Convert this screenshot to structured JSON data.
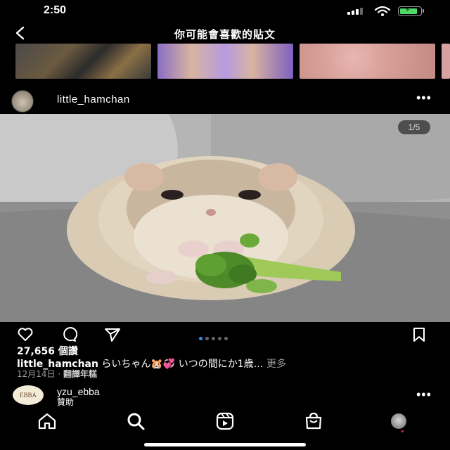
{
  "status_bar": {
    "time": "2:50"
  },
  "header": {
    "title": "你可能會喜歡的貼文"
  },
  "post": {
    "username": "little_hamchan",
    "image_counter": "1/5",
    "carousel": {
      "total": 5,
      "active_index": 0
    },
    "likes": "27,656 個讚",
    "caption_user": "little_hamchan",
    "caption_text": "らいちゃん🐹💞 いつの間にか1歳…",
    "caption_more": "更多",
    "date": "12月14日",
    "separator": "·",
    "translate": "翻譯年糕"
  },
  "next_post": {
    "username": "yzu_ebba",
    "label": "贊助",
    "avatar_text": "EBBA"
  },
  "icons": {
    "back": "chevron-left-icon",
    "like": "heart-icon",
    "comment": "comment-icon",
    "share": "send-icon",
    "save": "bookmark-icon",
    "home": "home-icon",
    "search": "search-icon",
    "reels": "reels-icon",
    "shop": "shop-icon"
  },
  "colors": {
    "accent": "#3a8ef0",
    "battery": "#4cd964",
    "background": "#000000"
  }
}
